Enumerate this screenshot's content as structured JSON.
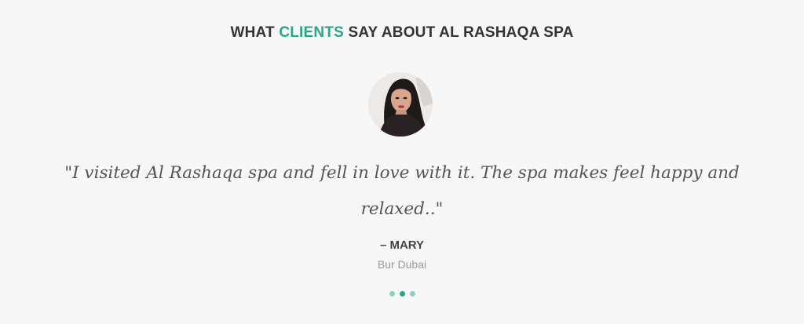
{
  "testimonials": {
    "heading_prefix": "WHAT ",
    "heading_accent": "CLIENTS",
    "heading_suffix": " SAY ABOUT AL RASHAQA SPA",
    "quote": "\"I visited Al Rashaqa spa and fell in love with it. The spa makes feel happy and relaxed..\"",
    "author": "– MARY",
    "location": "Bur Dubai",
    "avatar_icon": "person-photo-icon",
    "slides_count": 3,
    "active_slide": 2
  },
  "colors": {
    "accent": "#2aa589",
    "dot_inactive": "#8fcfc0",
    "background": "#f7f7f7"
  }
}
